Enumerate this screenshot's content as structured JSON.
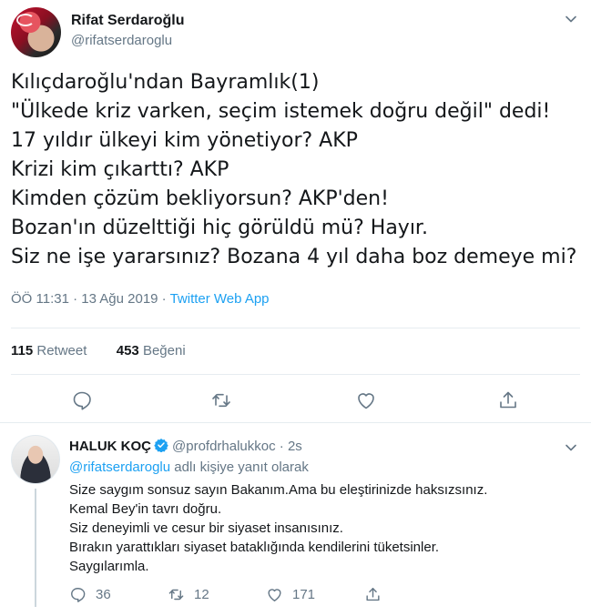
{
  "tweet": {
    "display_name": "Rifat Serdaroğlu",
    "handle": "@rifatserdaroglu",
    "lines": [
      "Kılıçdaroğlu'ndan Bayramlık(1)",
      "\"Ülkede kriz varken, seçim istemek doğru değil\" dedi!",
      "17 yıldır ülkeyi kim yönetiyor? AKP",
      "Krizi kim çıkarttı? AKP",
      "Kimden çözüm bekliyorsun? AKP'den!",
      "Bozan'ın düzelttiği hiç görüldü mü? Hayır.",
      "Siz ne işe yararsınız? Bozana 4 yıl daha boz demeye mi?"
    ],
    "timestamp": "ÖÖ 11:31 · 13 Ağu 2019 · ",
    "source": "Twitter Web App",
    "retweet_count": "115",
    "retweet_label": "Retweet",
    "like_count": "453",
    "like_label": "Beğeni"
  },
  "reply": {
    "display_name": "HALUK KOÇ",
    "handle": "@profdrhalukkoc · 2s",
    "replying_mention": "@rifatserdaroglu",
    "replying_suffix": " adlı kişiye yanıt olarak",
    "lines": [
      "Size saygım sonsuz sayın Bakanım.Ama bu eleştirinizde haksızsınız.",
      "Kemal Bey'in tavrı doğru.",
      "Siz deneyimli ve cesur bir siyaset insanısınız.",
      "Bırakın yarattıkları siyaset bataklığında kendilerini tüketsinler.",
      "Saygılarımla."
    ],
    "reply_count": "36",
    "retweet_count": "12",
    "like_count": "171"
  },
  "colors": {
    "accent": "#1da1f2",
    "icon": "#657786",
    "text": "#14171a"
  },
  "icons": [
    "chevron-down-icon",
    "reply-icon",
    "retweet-icon",
    "like-icon",
    "share-icon",
    "verified-icon"
  ]
}
